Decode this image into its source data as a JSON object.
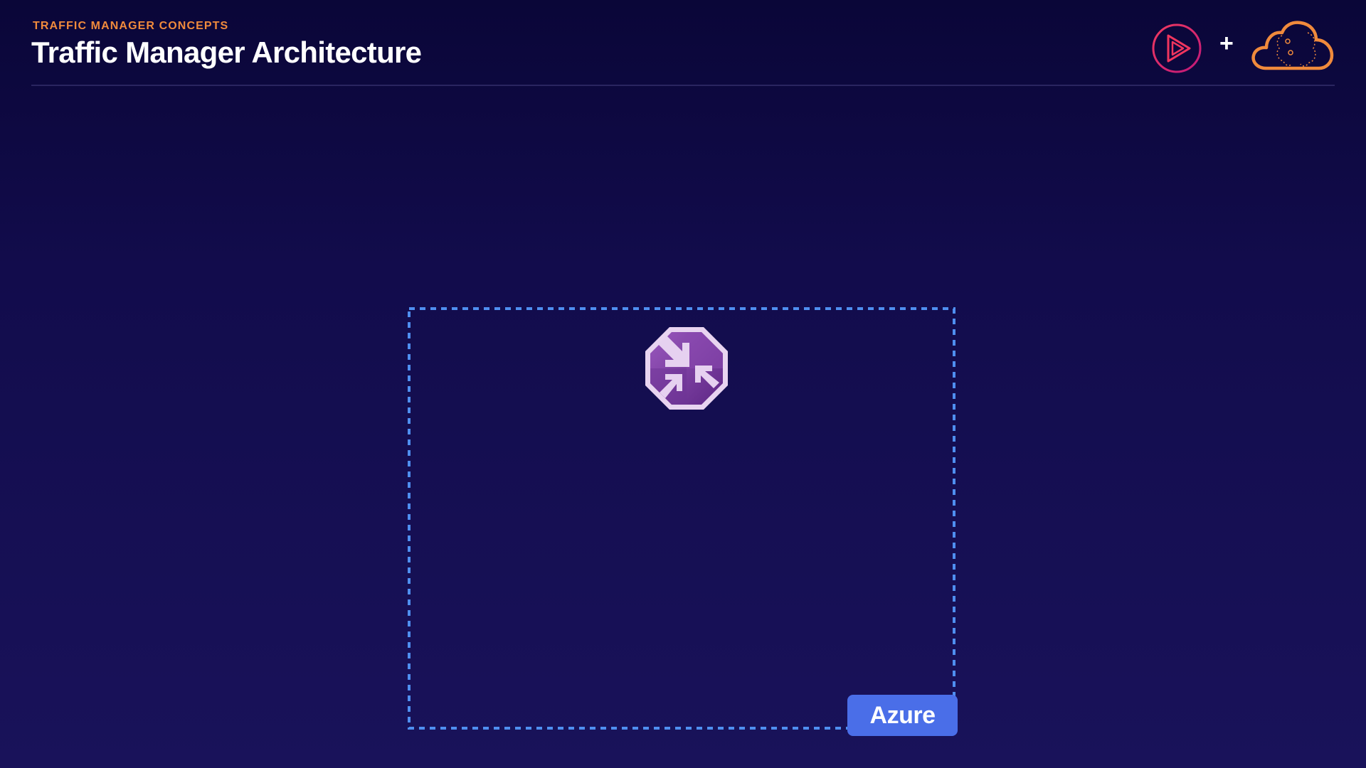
{
  "header": {
    "eyebrow": "TRAFFIC MANAGER CONCEPTS",
    "title": "Traffic Manager Architecture"
  },
  "brand": {
    "plus": "+",
    "play_icon": "pluralsight-play-icon",
    "cloud_icon": "cloud-brain-icon"
  },
  "diagram": {
    "region_label": "Azure",
    "service_icon": "traffic-manager-icon"
  },
  "colors": {
    "accent_orange": "#f08a3c",
    "region_border": "#4f8ff0",
    "badge": "#4a6ee8",
    "tm_purple": "#7a3d9c",
    "play_ring": "#e0246a"
  }
}
